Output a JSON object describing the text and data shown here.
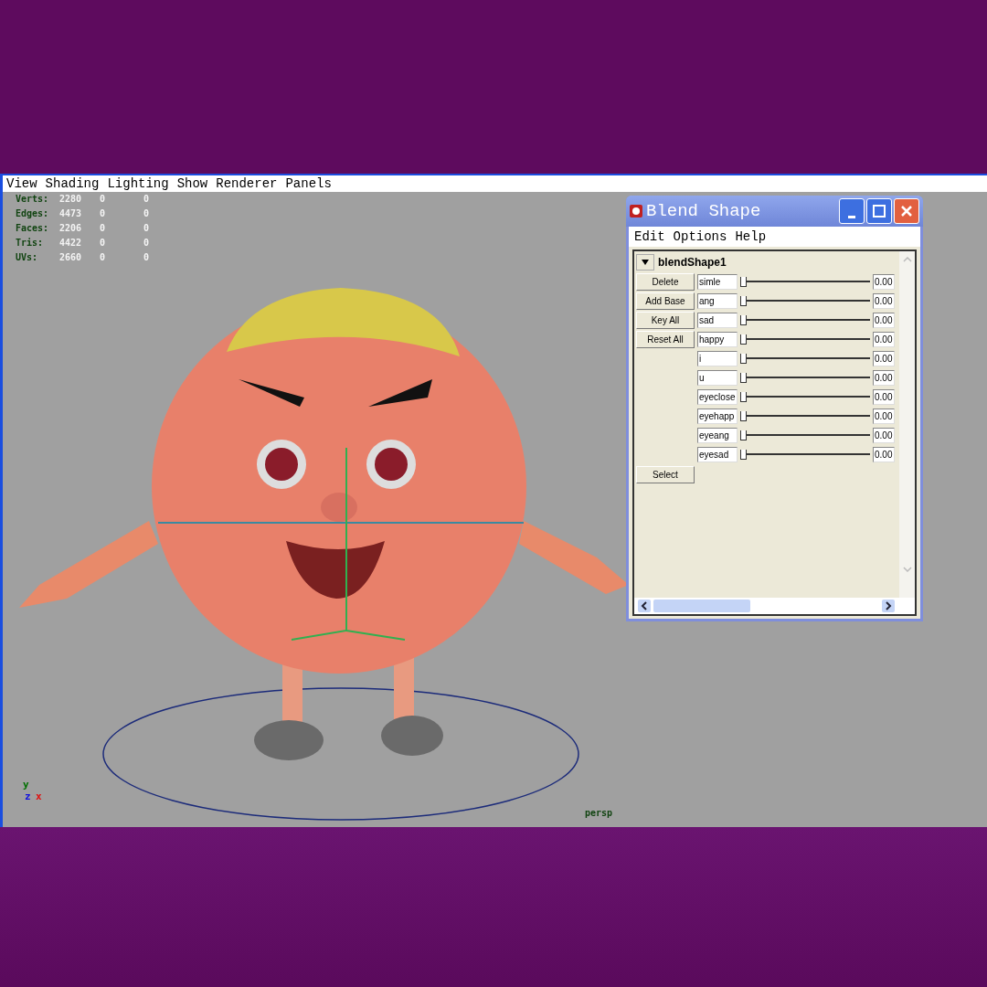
{
  "viewport": {
    "menu": [
      "View",
      "Shading",
      "Lighting",
      "Show",
      "Renderer",
      "Panels"
    ],
    "stats": [
      {
        "label": "Verts:",
        "values": [
          "2280",
          "0",
          "0"
        ]
      },
      {
        "label": "Edges:",
        "values": [
          "4473",
          "0",
          "0"
        ]
      },
      {
        "label": "Faces:",
        "values": [
          "2206",
          "0",
          "0"
        ]
      },
      {
        "label": "Tris:",
        "values": [
          "4422",
          "0",
          "0"
        ]
      },
      {
        "label": "UVs:",
        "values": [
          "2660",
          "0",
          "0"
        ]
      }
    ],
    "axes": [
      {
        "label": "y",
        "color": "#007000"
      },
      {
        "label": "z",
        "color": "#1010e0"
      },
      {
        "label": "x",
        "color": "#e01010"
      }
    ],
    "camera": "persp"
  },
  "blend_window": {
    "title": "Blend Shape",
    "menu": [
      "Edit",
      "Options",
      "Help"
    ],
    "node": {
      "name": "blendShape1",
      "expanded": true
    },
    "buttons": [
      "Delete",
      "Add Base",
      "Key All",
      "Reset All"
    ],
    "targets": [
      {
        "name": "simle",
        "level": 0,
        "value": "0.00"
      },
      {
        "name": "ang",
        "level": 0,
        "value": "0.00"
      },
      {
        "name": "sad",
        "level": 0,
        "value": "0.00"
      },
      {
        "name": "happy",
        "level": 0,
        "value": "0.00"
      },
      {
        "name": "i",
        "level": 0,
        "value": "0.00"
      },
      {
        "name": "u",
        "level": 0,
        "value": "0.00"
      },
      {
        "name": "eyeclose",
        "level": 0,
        "value": "0.00"
      },
      {
        "name": "eyehapp",
        "level": 0,
        "value": "0.00"
      },
      {
        "name": "eyeang",
        "level": 0,
        "value": "0.00"
      },
      {
        "name": "eyesad",
        "level": 0,
        "value": "0.00"
      }
    ],
    "select_button": "Select"
  }
}
